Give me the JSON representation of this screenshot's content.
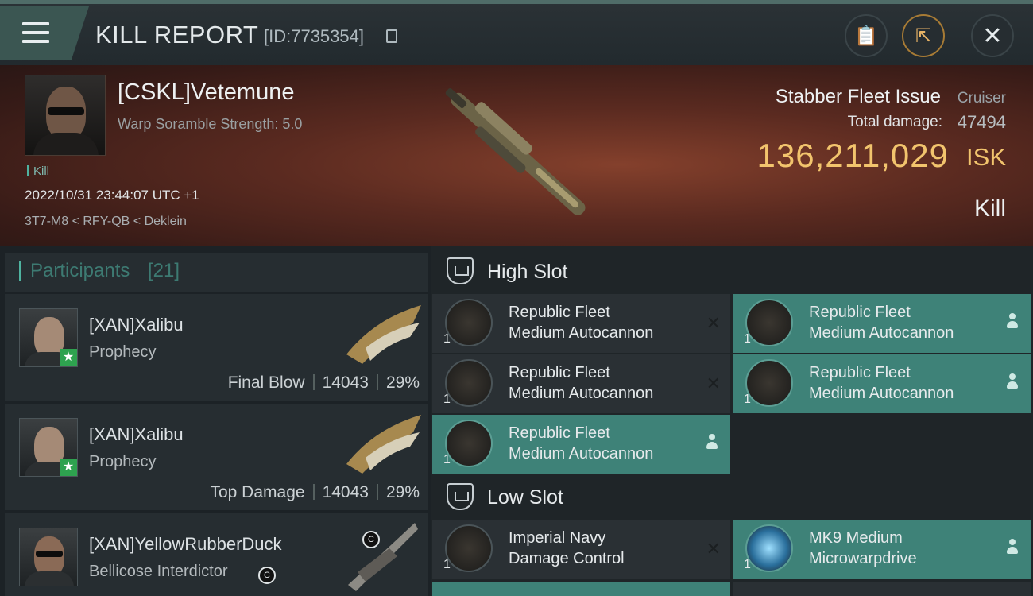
{
  "header": {
    "title": "KILL REPORT",
    "report_id": "[ID:7735354]",
    "menu_icon": "hamburger-menu-icon",
    "clipboard_icon": "clipboard-icon",
    "share_icon": "external-share-icon",
    "close_icon": "close-icon",
    "close_glyph": "✕",
    "clipboard_glyph": "📋",
    "share_glyph": "⇱"
  },
  "victim": {
    "name": "[CSKL]Vetemune",
    "scramble": "Warp Soramble Strength: 5.0",
    "tag": "Kill",
    "datetime": "2022/10/31 23:44:07 UTC +1",
    "location": "3T7-M8 < RFY-QB < Deklein"
  },
  "ship": {
    "name": "Stabber Fleet Issue",
    "class": "Cruiser",
    "damage_label": "Total damage:",
    "damage_value": "47494",
    "isk_value": "136,211,029",
    "isk_unit": "ISK",
    "result": "Kill"
  },
  "participants": {
    "label": "Participants",
    "count": "[21]",
    "rows": [
      {
        "name": "[XAN]Xalibu",
        "ship": "Prophecy",
        "role": "Final Blow",
        "damage": "14043",
        "percent": "29%",
        "star": "★"
      },
      {
        "name": "[XAN]Xalibu",
        "ship": "Prophecy",
        "role": "Top Damage",
        "damage": "14043",
        "percent": "29%",
        "star": "★"
      },
      {
        "name": "[XAN]YellowRubberDuck",
        "ship": "Bellicose Interdictor",
        "badge_a": "C",
        "badge_b": "C"
      }
    ]
  },
  "high_slot": {
    "label": "High Slot",
    "modules": [
      {
        "line1": "Republic Fleet",
        "line2": "Medium Autocannon",
        "qty": "1",
        "status": "destroyed",
        "mark": "✕"
      },
      {
        "line1": "Republic Fleet",
        "line2": "Medium Autocannon",
        "qty": "1",
        "status": "dropped"
      },
      {
        "line1": "Republic Fleet",
        "line2": "Medium Autocannon",
        "qty": "1",
        "status": "destroyed",
        "mark": "✕"
      },
      {
        "line1": "Republic Fleet",
        "line2": "Medium Autocannon",
        "qty": "1",
        "status": "dropped"
      },
      {
        "line1": "Republic Fleet",
        "line2": "Medium Autocannon",
        "qty": "1",
        "status": "dropped"
      }
    ]
  },
  "low_slot": {
    "label": "Low Slot",
    "modules": [
      {
        "line1": "Imperial Navy",
        "line2": "Damage Control",
        "qty": "1",
        "status": "destroyed",
        "mark": "✕"
      },
      {
        "line1": "MK9 Medium",
        "line2": "Microwarpdrive",
        "qty": "1",
        "status": "dropped"
      }
    ]
  },
  "colors": {
    "accent_teal": "#3e8278",
    "isk_gold": "#f2c46d",
    "hero_red": "#84402c",
    "star_green": "#2ea24f"
  }
}
